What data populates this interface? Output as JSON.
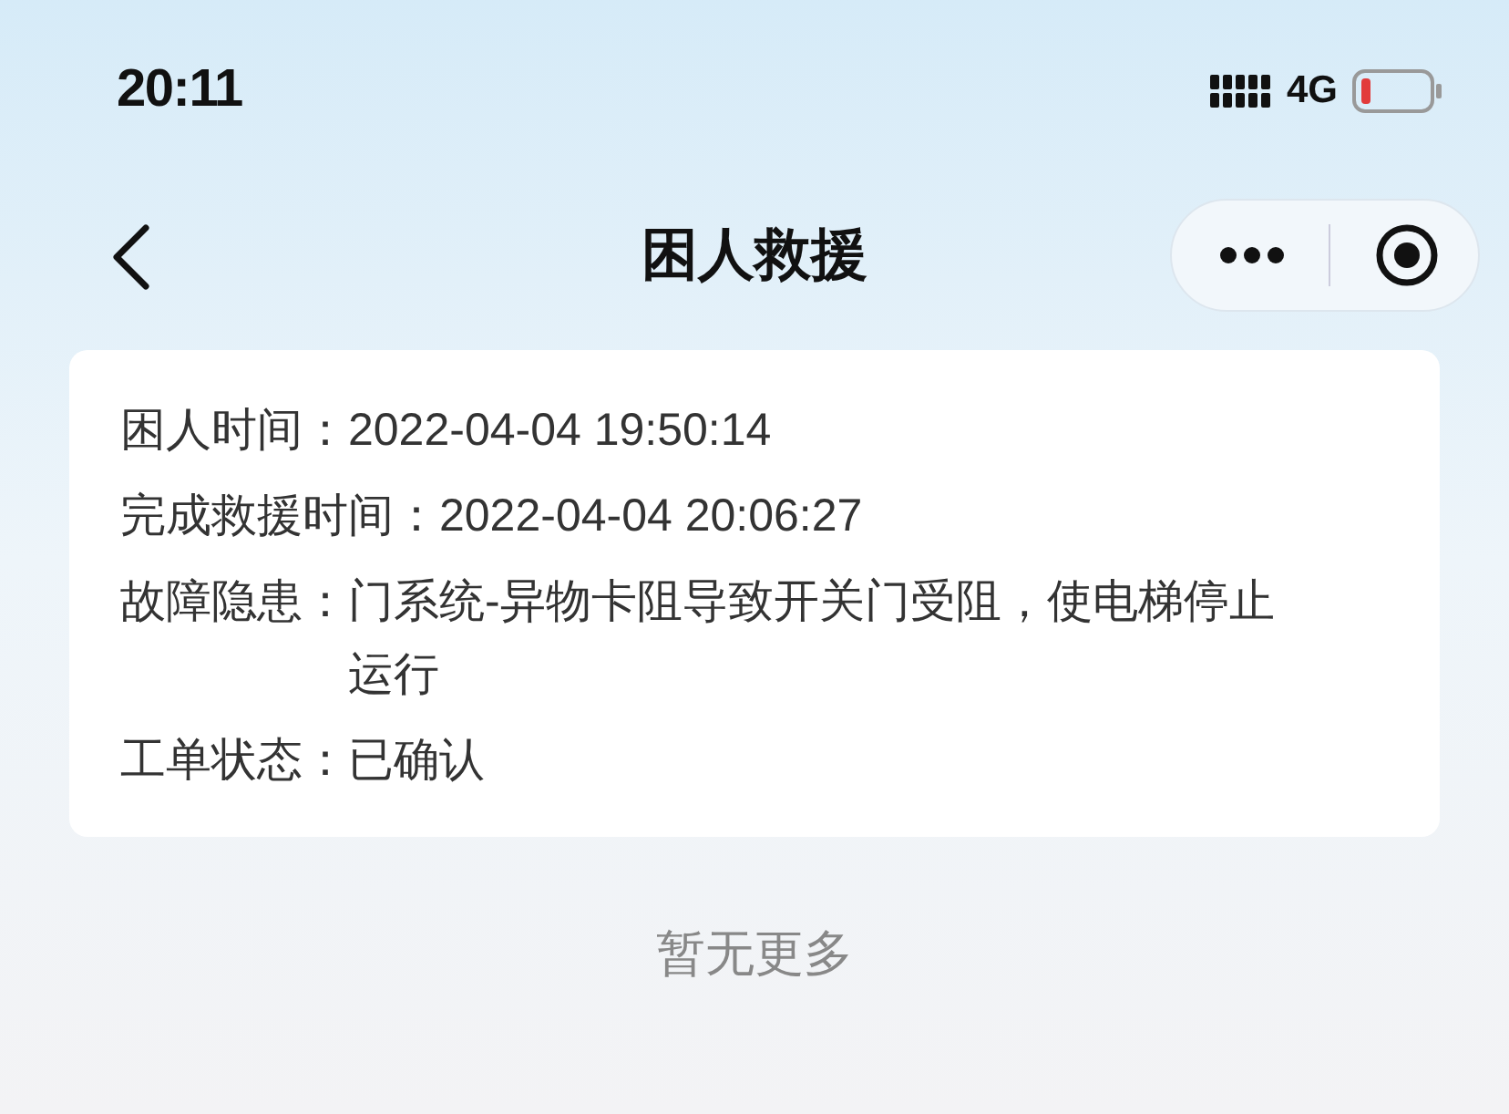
{
  "status_bar": {
    "time": "20:11",
    "network": "4G"
  },
  "nav": {
    "title": "困人救援"
  },
  "details": [
    {
      "label": "困人时间：",
      "value": "2022-04-04 19:50:14"
    },
    {
      "label": "完成救援时间：",
      "value": "2022-04-04 20:06:27"
    },
    {
      "label": "故障隐患：",
      "value": "门系统-异物卡阻导致开关门受阻，使电梯停止运行"
    },
    {
      "label": "工单状态：",
      "value": "已确认"
    }
  ],
  "footer": "暂无更多"
}
